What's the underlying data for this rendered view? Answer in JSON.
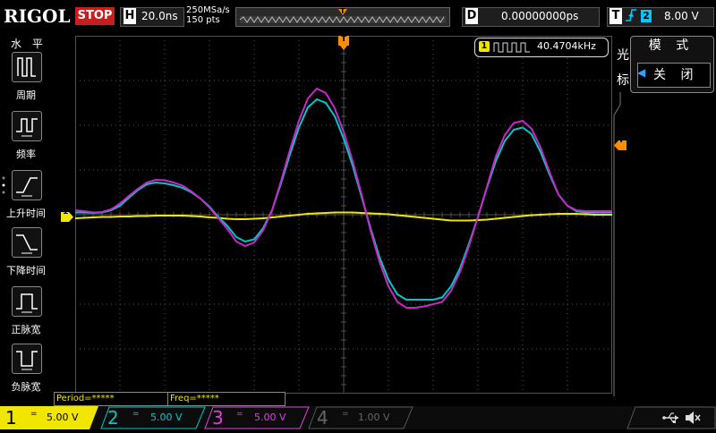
{
  "brand": "RIGOL",
  "status": "STOP",
  "horizontal": {
    "letter": "H",
    "timebase": "20.0ns",
    "sample_rate": "250MSa/s",
    "points": "150 pts"
  },
  "trigger_marker": "T",
  "delay": {
    "letter": "D",
    "value": "0.00000000ps"
  },
  "trigger": {
    "letter": "T",
    "edge_icon": "rising-edge-icon",
    "source": "2",
    "level": "8.00 V"
  },
  "left_menu": {
    "title": "水 平",
    "items": [
      {
        "label": "周期",
        "icon": "period-icon"
      },
      {
        "label": "频率",
        "icon": "frequency-icon"
      },
      {
        "label": "上升时间",
        "icon": "rise-time-icon"
      },
      {
        "label": "下降时间",
        "icon": "fall-time-icon"
      },
      {
        "label": "正脉宽",
        "icon": "positive-width-icon"
      },
      {
        "label": "负脉宽",
        "icon": "negative-width-icon"
      }
    ]
  },
  "cursor_label": "光标",
  "mode_panel": {
    "title": "模 式",
    "value": "关 闭"
  },
  "freq_counter": {
    "channel": "1",
    "value": "40.4704kHz"
  },
  "measurements": {
    "period": "Period=*****",
    "freq": "Freq=*****"
  },
  "channel_marker": "1",
  "trigger_level_marker": "T",
  "channels": [
    {
      "num": "1",
      "coupling": "=",
      "scale": "5.00 V",
      "color": "#f0e600"
    },
    {
      "num": "2",
      "coupling": "=",
      "scale": "5.00 V",
      "color": "#00c8c8"
    },
    {
      "num": "3",
      "coupling": "=",
      "scale": "5.00 V",
      "color": "#e040e0"
    },
    {
      "num": "4",
      "coupling": "=",
      "scale": "1.00 V",
      "color": "#3070ff"
    }
  ],
  "colors": {
    "ch1": "#f0e600",
    "ch2": "#00c8c8",
    "ch3": "#c828c8",
    "trigger": "#ff8c00",
    "grid": "#505050",
    "accent": "#29a8ff"
  },
  "chart_data": {
    "type": "line",
    "x_divisions": 12,
    "y_divisions": 8,
    "series": [
      {
        "values": [
          -0.08,
          -0.07,
          -0.06,
          -0.05,
          -0.05,
          -0.04,
          -0.04,
          -0.03,
          -0.03,
          -0.02,
          -0.02,
          -0.02,
          -0.02,
          -0.03,
          -0.04,
          -0.06,
          -0.07,
          -0.09,
          -0.1,
          -0.1,
          -0.09,
          -0.08,
          -0.06,
          -0.04,
          -0.02,
          0.0,
          0.02,
          0.03,
          0.04,
          0.05,
          0.05,
          0.05,
          0.04,
          0.03,
          0.02,
          0.01,
          -0.01,
          -0.03,
          -0.05,
          -0.07,
          -0.09,
          -0.11,
          -0.13,
          -0.13,
          -0.13,
          -0.12,
          -0.11,
          -0.09,
          -0.07,
          -0.05,
          -0.03,
          -0.01,
          0.0,
          0.01,
          0.02,
          0.02,
          0.02,
          0.01,
          0.0,
          0.0,
          0.0
        ]
      },
      {
        "values": [
          0.05,
          0.05,
          0.04,
          0.05,
          0.1,
          0.2,
          0.38,
          0.55,
          0.68,
          0.72,
          0.7,
          0.66,
          0.6,
          0.5,
          0.36,
          0.18,
          -0.05,
          -0.25,
          -0.5,
          -0.6,
          -0.55,
          -0.3,
          0.1,
          0.7,
          1.35,
          1.95,
          2.4,
          2.58,
          2.5,
          2.2,
          1.7,
          1.1,
          0.4,
          -0.3,
          -0.95,
          -1.45,
          -1.78,
          -1.9,
          -1.9,
          -1.9,
          -1.9,
          -1.85,
          -1.6,
          -1.2,
          -0.65,
          -0.05,
          0.6,
          1.2,
          1.65,
          1.9,
          1.95,
          1.8,
          1.4,
          0.9,
          0.45,
          0.2,
          0.08,
          0.05,
          0.05,
          0.05,
          0.05
        ]
      },
      {
        "values": [
          0.1,
          0.08,
          0.05,
          0.06,
          0.12,
          0.25,
          0.42,
          0.58,
          0.72,
          0.78,
          0.77,
          0.72,
          0.65,
          0.52,
          0.36,
          0.16,
          -0.08,
          -0.32,
          -0.6,
          -0.7,
          -0.62,
          -0.35,
          0.1,
          0.75,
          1.45,
          2.1,
          2.6,
          2.82,
          2.72,
          2.38,
          1.85,
          1.2,
          0.45,
          -0.35,
          -1.05,
          -1.6,
          -1.95,
          -2.08,
          -2.08,
          -2.05,
          -2.0,
          -1.95,
          -1.7,
          -1.28,
          -0.7,
          -0.05,
          0.62,
          1.3,
          1.78,
          2.05,
          2.1,
          1.92,
          1.5,
          0.95,
          0.45,
          0.2,
          0.1,
          0.08,
          0.08,
          0.08,
          0.08
        ]
      }
    ]
  }
}
